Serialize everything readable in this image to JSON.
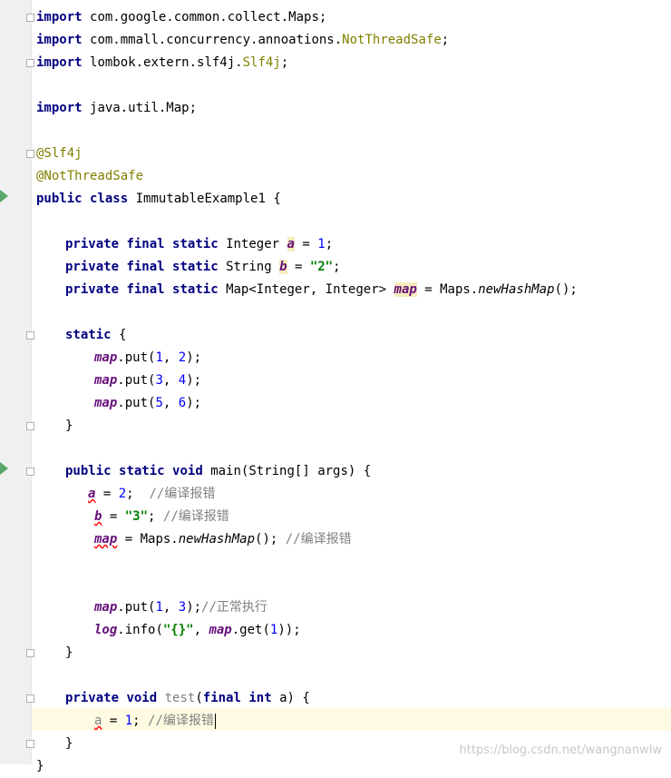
{
  "imports": {
    "kw": "import",
    "i1": "com.google.common.collect.Maps;",
    "i2_pre": "com.mmall.concurrency.annoations.",
    "i2_ann": "NotThreadSafe",
    "i3_pre": "lombok.extern.slf4j.",
    "i3_ann": "Slf4j",
    "i4": "java.util.Map;",
    "semi": ";"
  },
  "annotations": {
    "slf4j": "@Slf4j",
    "notthreadsafe": "@NotThreadSafe"
  },
  "class_decl": {
    "public": "public",
    "class": "class",
    "name": "ImmutableExample1 {"
  },
  "fields": {
    "private": "private",
    "final": "final",
    "static": "static",
    "f1_type": "Integer",
    "f1_name": "a",
    "f1_eq": " = ",
    "f1_val": "1",
    "f1_end": ";",
    "f2_type": "String",
    "f2_name": "b",
    "f2_eq": " = ",
    "f2_val": "\"2\"",
    "f2_end": ";",
    "f3_type": "Map<Integer, Integer>",
    "f3_name": "map",
    "f3_eq": " = Maps.",
    "f3_call": "newHashMap",
    "f3_end": "();"
  },
  "static_block": {
    "open_kw": "static",
    "open_brace": " {",
    "map": "map",
    "put": ".put(",
    "comma": ", ",
    "end": ");",
    "c1a": "1",
    "c1b": "2",
    "c2a": "3",
    "c2b": "4",
    "c3a": "5",
    "c3b": "6",
    "close": "}"
  },
  "main_method": {
    "public": "public",
    "static": "static",
    "void": "void",
    "sig": "main(String[] args) {",
    "l1_var": "a",
    "l1_eq": " = ",
    "l1_val": "2",
    "l1_semi": ";  ",
    "l1_cmt": "//编译报错",
    "l2_var": "b",
    "l2_eq": " = ",
    "l2_val": "\"3\"",
    "l2_semi": "; ",
    "l2_cmt": "//编译报错",
    "l3_var": "map",
    "l3_eq": " = Maps.",
    "l3_call": "newHashMap",
    "l3_end": "(); ",
    "l3_cmt": "//编译报错",
    "l4_map": "map",
    "l4_put": ".put(",
    "l4_a": "1",
    "l4_comma": ", ",
    "l4_b": "3",
    "l4_end": ");",
    "l4_cmt": "//正常执行",
    "l5_log": "log",
    "l5_info": ".info(",
    "l5_str": "\"{}\"",
    "l5_comma": ", ",
    "l5_map": "map",
    "l5_get": ".get(",
    "l5_arg": "1",
    "l5_end": "));",
    "close": "}"
  },
  "test_method": {
    "private": "private",
    "void": "void",
    "name": "test",
    "paren": "(",
    "final": "final",
    "int": "int",
    "param": " a) {",
    "body_var": "a",
    "body_eq": " = ",
    "body_val": "1",
    "body_semi": "; ",
    "body_cmt": "//编译报错",
    "close": "}"
  },
  "class_close": "}",
  "watermark": "https://blog.csdn.net/wangnanwlw"
}
